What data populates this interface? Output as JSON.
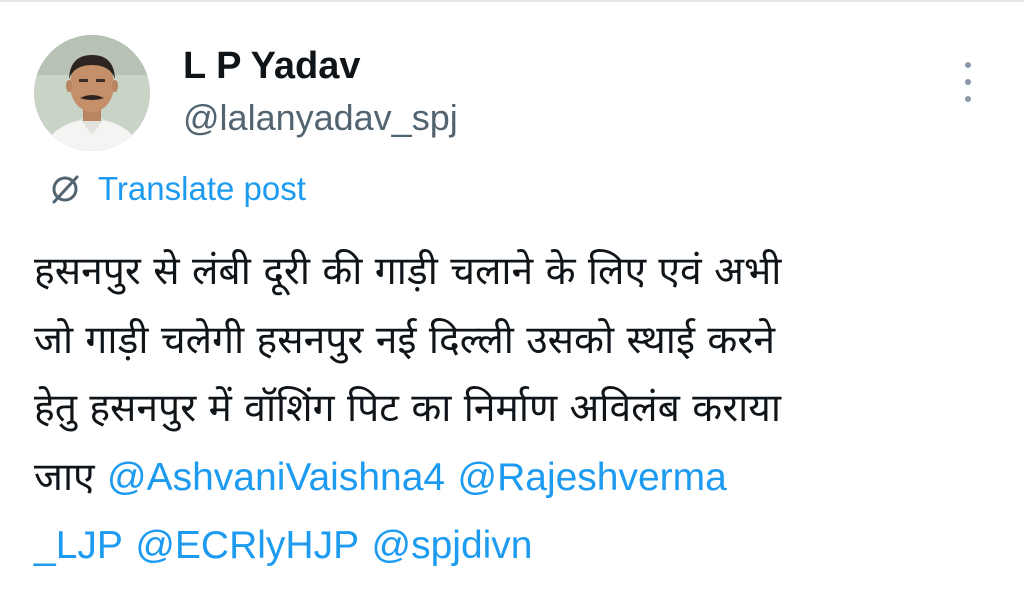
{
  "author": {
    "display_name": "L P Yadav",
    "handle": "@lalanyadav_spj",
    "avatar": "profile-photo"
  },
  "menu": {
    "icon": "vertical-ellipsis-icon"
  },
  "translate": {
    "icon": "translate-globe-icon",
    "label": "Translate post"
  },
  "post": {
    "lines": [
      "हसनपुर से लंबी दूरी की गाड़ी चलाने के लिए एवं अभी",
      "जो गाड़ी चलेगी हसनपुर नई दिल्ली उसको स्थाई करने",
      "हेतु हसनपुर में वॉशिंग पिट का निर्माण अविलंब कराया"
    ],
    "line4_text": "जाए",
    "mentions": [
      "@AshvaniVaishna4",
      "@Rajeshverma",
      "_LJP",
      "@ECRlyHJP",
      "@spjdivn"
    ]
  },
  "colors": {
    "text": "#0f1419",
    "secondary": "#536471",
    "link": "#1d9bf0"
  }
}
